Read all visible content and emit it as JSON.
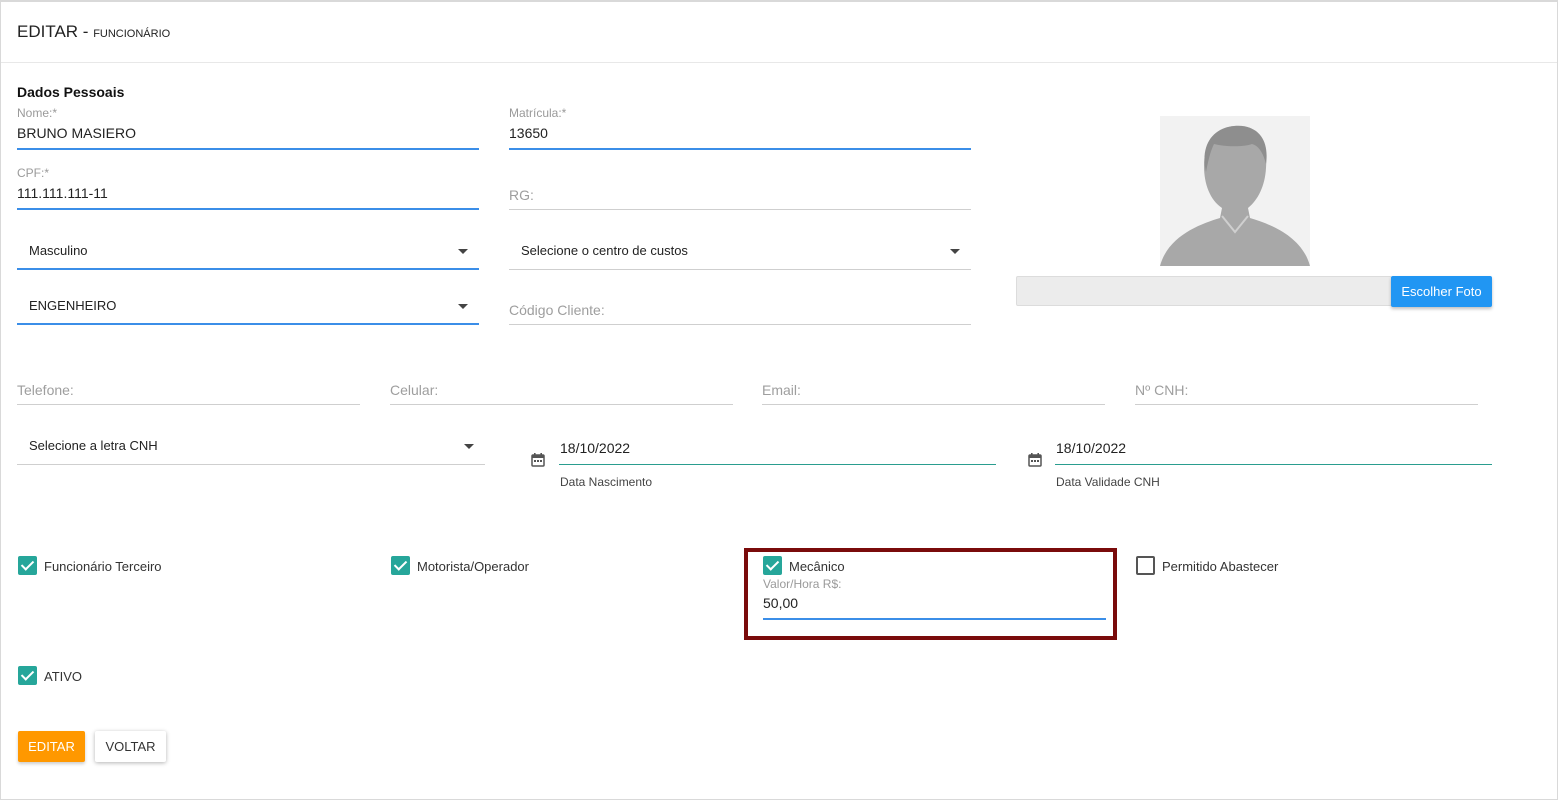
{
  "header": {
    "title": "EDITAR",
    "separator": " - ",
    "subtitle": "FUNCIONÁRIO"
  },
  "section": {
    "title": "Dados Pessoais"
  },
  "fields": {
    "nome": {
      "label": "Nome:*",
      "value": "BRUNO MASIERO"
    },
    "matricula": {
      "label": "Matrícula:*",
      "value": "13650"
    },
    "cpf": {
      "label": "CPF:*",
      "value": "111.111.111-11"
    },
    "rg": {
      "placeholder": "RG:"
    },
    "sexo": {
      "value": "Masculino"
    },
    "centro_custos": {
      "value": "Selecione o centro de custos"
    },
    "cargo": {
      "value": "ENGENHEIRO"
    },
    "codigo_cliente": {
      "placeholder": "Código Cliente:"
    },
    "telefone": {
      "placeholder": "Telefone:"
    },
    "celular": {
      "placeholder": "Celular:"
    },
    "email": {
      "placeholder": "Email:"
    },
    "cnh": {
      "placeholder": "Nº CNH:"
    },
    "letra_cnh": {
      "value": "Selecione a letra CNH"
    },
    "data_nascimento": {
      "value": "18/10/2022",
      "hint": "Data Nascimento"
    },
    "data_validade_cnh": {
      "value": "18/10/2022",
      "hint": "Data Validade CNH"
    },
    "valor_hora": {
      "label": "Valor/Hora R$:",
      "value": "50,00"
    }
  },
  "photo": {
    "button_label": "Escolher Foto"
  },
  "checkboxes": {
    "funcionario_terceiro": {
      "label": "Funcionário Terceiro",
      "checked": true
    },
    "motorista_operador": {
      "label": "Motorista/Operador",
      "checked": true
    },
    "mecanico": {
      "label": "Mecânico",
      "checked": true
    },
    "permitido_abastecer": {
      "label": "Permitido Abastecer",
      "checked": false
    },
    "ativo": {
      "label": "ATIVO",
      "checked": true
    }
  },
  "actions": {
    "edit_label": "EDITAR",
    "back_label": "VOLTAR"
  },
  "colors": {
    "accent_blue": "#2196f3",
    "teal": "#26a69a",
    "orange": "#ff9800",
    "highlight": "#7a0b0b"
  }
}
